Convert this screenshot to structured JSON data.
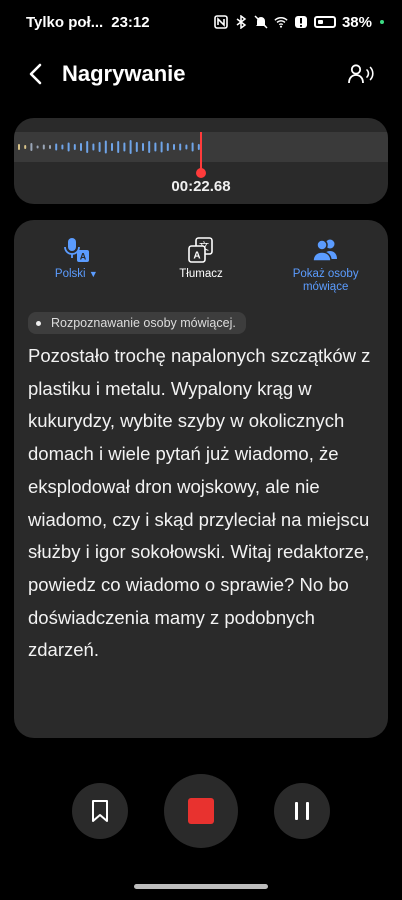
{
  "status_bar": {
    "carrier": "Tylko poł...",
    "time": "23:12",
    "battery": "38%",
    "icons": [
      "nfc-icon",
      "bluetooth-icon",
      "mute-icon",
      "wifi-icon",
      "alert-icon",
      "battery-icon"
    ]
  },
  "header": {
    "title": "Nagrywanie"
  },
  "recording": {
    "elapsed": "00:22.68"
  },
  "tools": {
    "language": "Polski",
    "translate": "Tłumacz",
    "speakers": "Pokaż osoby mówiące"
  },
  "chip": {
    "label": "Rozpoznawanie osoby mówiącej."
  },
  "transcript": {
    "text": "Pozostało trochę napalonych szczątków z plastiku i metalu. Wypalony krąg w kukurydzy, wybite szyby w okolicznych domach i wiele pytań już wiadomo, że eksplodował dron wojskowy, ale nie wiadomo, czy i skąd przyleciał na miejscu służby i igor sokołowski. Witaj redaktorze, powiedz co wiadomo o sprawie? No bo doświadczenia mamy z podobnych zdarzeń."
  },
  "colors": {
    "accent": "#5b9cff",
    "record": "#e8322f",
    "playhead": "#ff3b3b",
    "card": "#2a2a2a"
  }
}
